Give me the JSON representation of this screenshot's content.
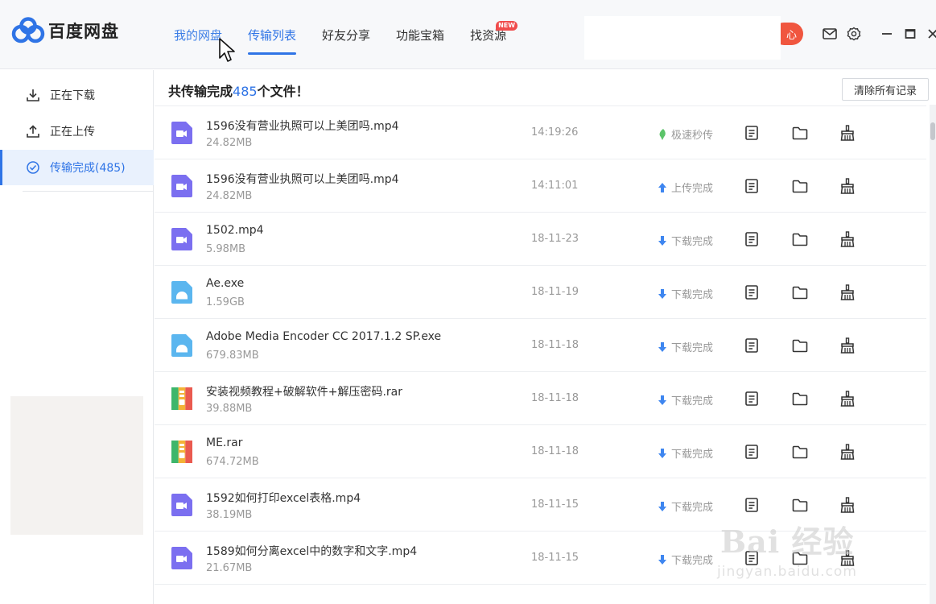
{
  "app": {
    "name": "百度网盘",
    "brand_color": "#2f74e6"
  },
  "nav": [
    {
      "label": "我的网盘"
    },
    {
      "label": "传输列表"
    },
    {
      "label": "好友分享"
    },
    {
      "label": "功能宝箱"
    },
    {
      "label": "找资源",
      "badge": "NEW"
    }
  ],
  "header": {
    "pill_text": "心",
    "icons": [
      "mail-icon",
      "settings-icon",
      "minimize-icon",
      "maximize-icon",
      "close-icon"
    ]
  },
  "sidebar": {
    "items": [
      {
        "label": "正在下载",
        "icon": "download-icon"
      },
      {
        "label": "正在上传",
        "icon": "upload-icon"
      },
      {
        "label": "传输完成(485)",
        "icon": "check-circle-icon"
      }
    ]
  },
  "summary": {
    "prefix": "共传输完成",
    "count": "485",
    "suffix": "个文件！"
  },
  "clear_button": "清除所有记录",
  "files": [
    {
      "name": "1596没有营业执照可以上美团吗.mp4",
      "size": "24.82MB",
      "time": "14:19:26",
      "status": "极速秒传",
      "type": "video"
    },
    {
      "name": "1596没有营业执照可以上美团吗.mp4",
      "size": "24.82MB",
      "time": "14:11:01",
      "status": "上传完成",
      "type": "video"
    },
    {
      "name": "1502.mp4",
      "size": "5.98MB",
      "time": "18-11-23",
      "status": "下载完成",
      "type": "video"
    },
    {
      "name": "Ae.exe",
      "size": "1.59GB",
      "time": "18-11-19",
      "status": "下载完成",
      "type": "exe"
    },
    {
      "name": "Adobe Media Encoder CC 2017.1.2 SP.exe",
      "size": "679.83MB",
      "time": "18-11-18",
      "status": "下载完成",
      "type": "exe"
    },
    {
      "name": "安装视频教程+破解软件+解压密码.rar",
      "size": "39.88MB",
      "time": "18-11-18",
      "status": "下载完成",
      "type": "rar"
    },
    {
      "name": "ME.rar",
      "size": "674.72MB",
      "time": "18-11-18",
      "status": "下载完成",
      "type": "rar"
    },
    {
      "name": "1592如何打印excel表格.mp4",
      "size": "38.19MB",
      "time": "18-11-15",
      "status": "下载完成",
      "type": "video"
    },
    {
      "name": "1589如何分离excel中的数字和文字.mp4",
      "size": "21.67MB",
      "time": "18-11-15",
      "status": "下载完成",
      "type": "video"
    }
  ],
  "watermark": {
    "brand": "Bai 经验",
    "url": "jingyan.baidu.com"
  }
}
